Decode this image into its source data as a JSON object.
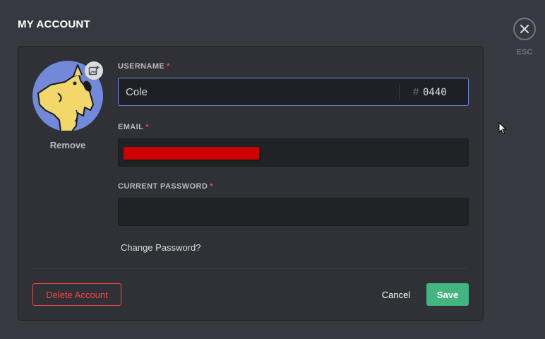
{
  "header": {
    "title": "MY ACCOUNT"
  },
  "close": {
    "esc_label": "ESC",
    "icon": "close-icon"
  },
  "avatar": {
    "remove_label": "Remove",
    "edit_icon": "add-image-icon",
    "bg_color": "#7289da"
  },
  "username": {
    "label": "USERNAME",
    "required": "*",
    "value": "Cole",
    "hash": "#",
    "tag": "0440"
  },
  "email": {
    "label": "EMAIL",
    "required": "*",
    "value_redacted": true
  },
  "password": {
    "label": "CURRENT PASSWORD",
    "required": "*",
    "value": ""
  },
  "links": {
    "change_password": "Change Password?"
  },
  "footer": {
    "delete_label": "Delete Account",
    "cancel_label": "Cancel",
    "save_label": "Save"
  },
  "colors": {
    "background": "#36393f",
    "card": "#2f3136",
    "accent": "#7289da",
    "danger": "#f04747",
    "success": "#43b581"
  }
}
